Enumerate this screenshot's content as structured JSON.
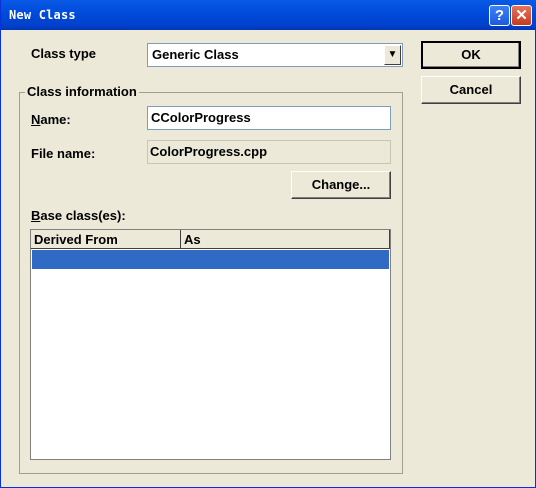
{
  "window": {
    "title": "New Class"
  },
  "class_type": {
    "label": "Class type",
    "selected": "Generic Class"
  },
  "buttons": {
    "ok": "OK",
    "cancel": "Cancel",
    "change": "Change..."
  },
  "class_info": {
    "group_label": "Class information",
    "name_label_mnemonic": "N",
    "name_label_rest": "ame:",
    "name_value": "CColorProgress",
    "file_label": "File name:",
    "file_value": "ColorProgress.cpp"
  },
  "base_classes": {
    "label_mnemonic": "B",
    "label_rest": "ase class(es):",
    "columns": [
      "Derived From",
      "As"
    ]
  }
}
